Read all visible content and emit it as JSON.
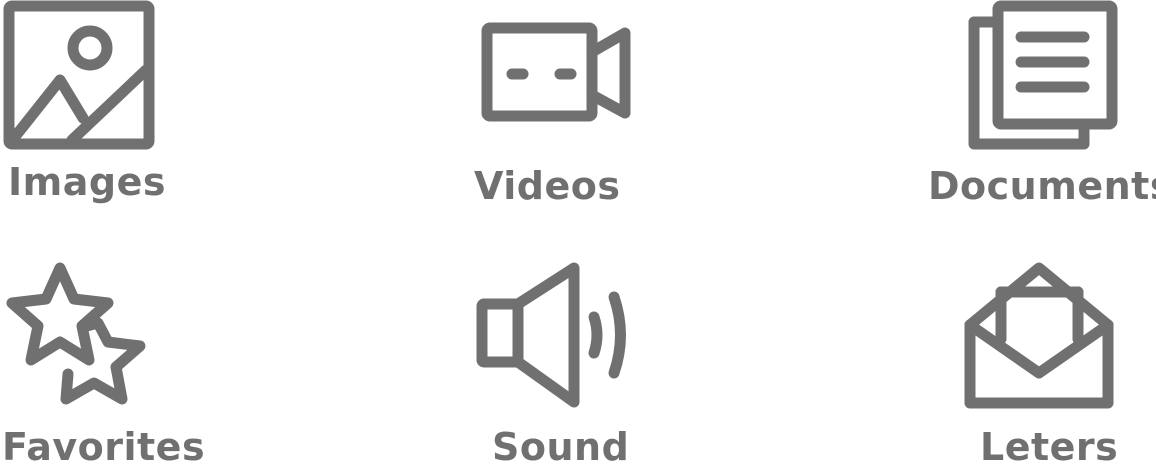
{
  "theme": {
    "icon_color": "#707070",
    "label_color": "#707070",
    "background": "#ffffff"
  },
  "tiles": [
    {
      "icon": "image-icon",
      "label": "Images"
    },
    {
      "icon": "video-camera-icon",
      "label": "Videos"
    },
    {
      "icon": "documents-icon",
      "label": "Documents"
    },
    {
      "icon": "stars-icon",
      "label": "Favorites"
    },
    {
      "icon": "speaker-icon",
      "label": "Sound"
    },
    {
      "icon": "open-envelope-icon",
      "label": "Leters"
    }
  ]
}
